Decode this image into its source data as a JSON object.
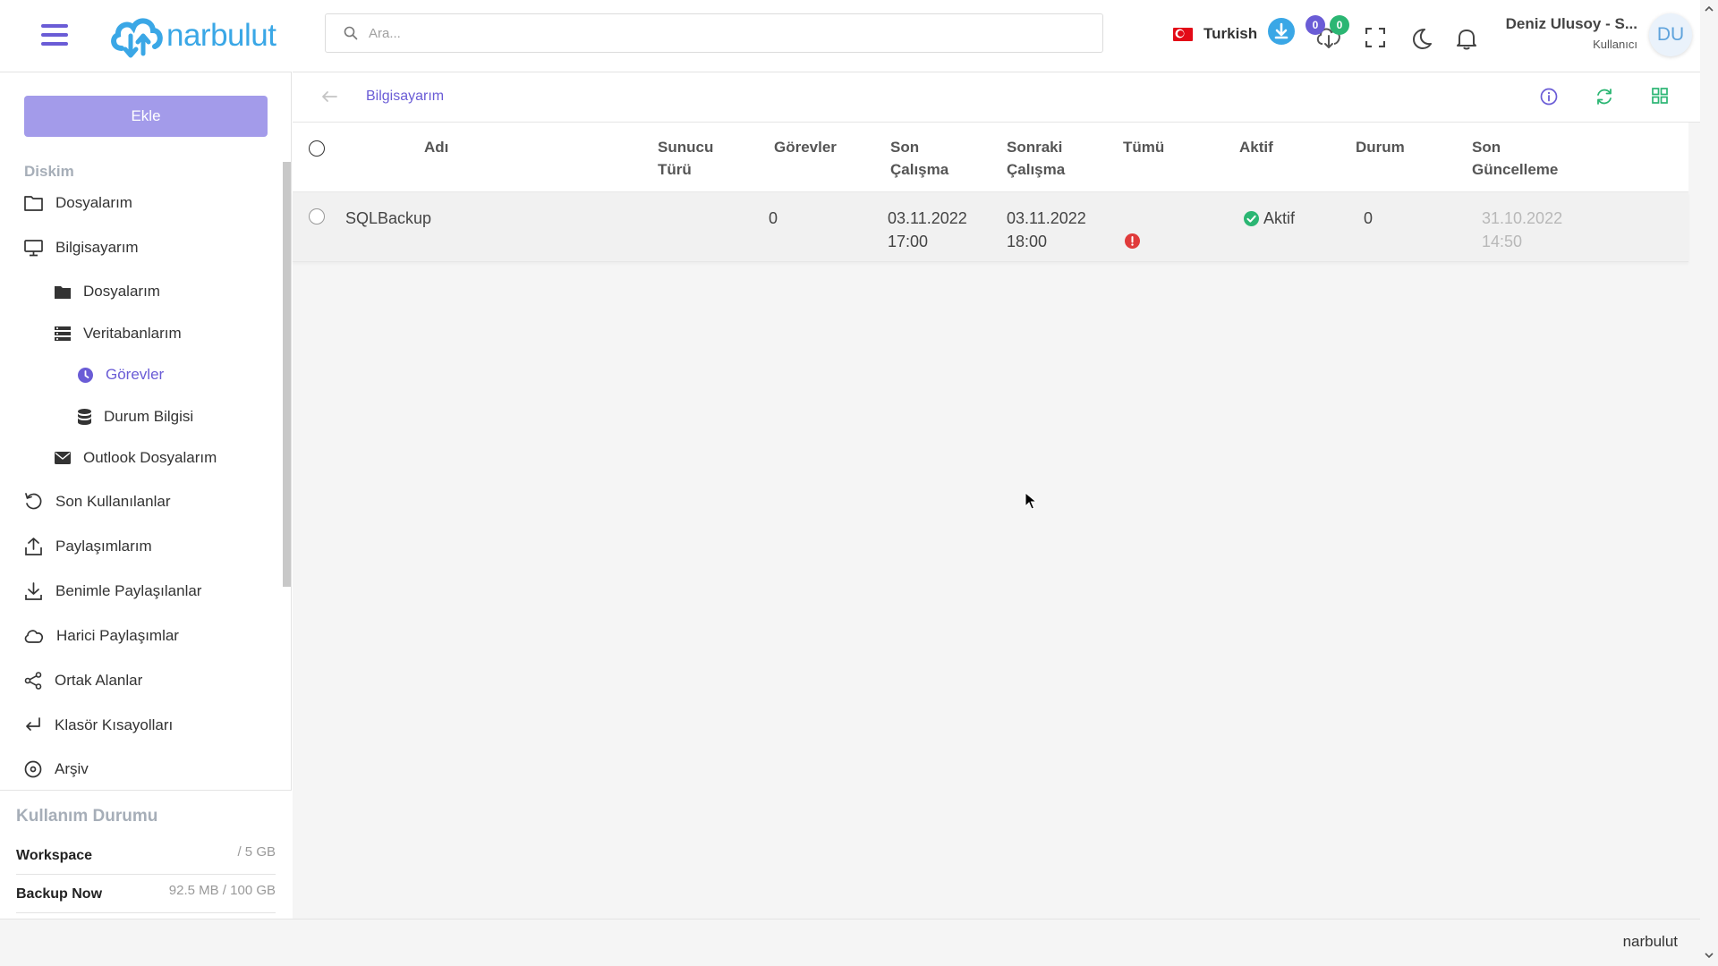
{
  "header": {
    "logo_text": "narbulut",
    "search_placeholder": "Ara...",
    "language": "Turkish",
    "download_badge": "0",
    "sync_badge": "0",
    "user_name": "Deniz Ulusoy - S...",
    "user_role": "Kullanıcı",
    "avatar_initials": "DU"
  },
  "sidebar": {
    "add_button": "Ekle",
    "section_title": "Diskim",
    "items": [
      {
        "label": "Dosyalarım",
        "icon": "folder-icon"
      },
      {
        "label": "Bilgisayarım",
        "icon": "monitor-icon"
      },
      {
        "label": "Dosyalarım",
        "icon": "folder-filled-icon"
      },
      {
        "label": "Veritabanlarım",
        "icon": "server-icon"
      },
      {
        "label": "Görevler",
        "icon": "clock-icon",
        "active": true
      },
      {
        "label": "Durum Bilgisi",
        "icon": "database-icon"
      },
      {
        "label": "Outlook Dosyalarım",
        "icon": "envelope-icon"
      },
      {
        "label": "Son Kullanılanlar",
        "icon": "history-icon"
      },
      {
        "label": "Paylaşımlarım",
        "icon": "upload-icon"
      },
      {
        "label": "Benimle Paylaşılanlar",
        "icon": "download-icon"
      },
      {
        "label": "Harici Paylaşımlar",
        "icon": "cloud-icon"
      },
      {
        "label": "Ortak Alanlar",
        "icon": "share-icon"
      },
      {
        "label": "Klasör Kısayolları",
        "icon": "return-arrow-icon"
      },
      {
        "label": "Arşiv",
        "icon": "archive-disc-icon"
      }
    ],
    "usage": {
      "title": "Kullanım Durumu",
      "rows": [
        {
          "name": "Workspace",
          "value": "/ 5 GB"
        },
        {
          "name": "Backup Now",
          "value": "92.5 MB / 100 GB"
        }
      ]
    }
  },
  "main": {
    "breadcrumb": "Bilgisayarım",
    "columns": [
      "Adı",
      "Sunucu\nTürü",
      "Görevler",
      "Son\nÇalışma",
      "Sonraki\nÇalışma",
      "Tümü",
      "Aktif",
      "Durum",
      "Son\nGüncelleme"
    ],
    "rows": [
      {
        "name": "SQLBackup",
        "server_type": "",
        "tasks": "0",
        "last_run": "03.11.2022\n17:00",
        "next_run": "03.11.2022\n18:00",
        "all_status": "error",
        "active": "Aktif",
        "status": "0",
        "last_update": "31.10.2022\n14:50"
      }
    ]
  },
  "footer": {
    "text": "narbulut"
  },
  "colors": {
    "accent": "#6a5cd6",
    "brand": "#3aa7e6",
    "add_button": "#a39bea",
    "success": "#2bb673",
    "error": "#e03b3b"
  }
}
